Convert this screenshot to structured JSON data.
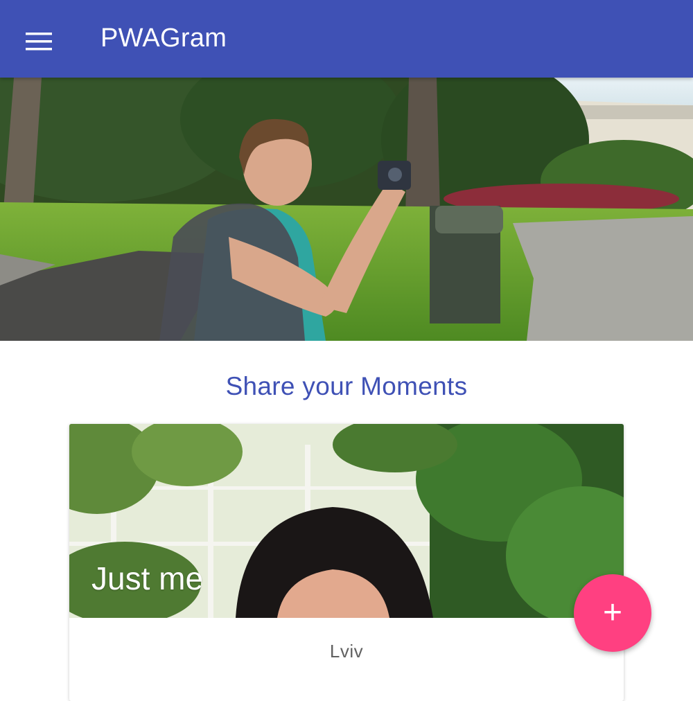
{
  "app_bar": {
    "title": "PWAGram",
    "menu_icon": "hamburger-menu-icon",
    "color": "#3f51b5"
  },
  "hero": {
    "image": "man-taking-photo-in-park"
  },
  "main": {
    "heading": "Share your Moments"
  },
  "card": {
    "title": "Just me",
    "location": "Lviv",
    "image": "woman-in-greenhouse"
  },
  "fab": {
    "label": "+",
    "icon": "add-icon",
    "color": "#ff4081"
  }
}
